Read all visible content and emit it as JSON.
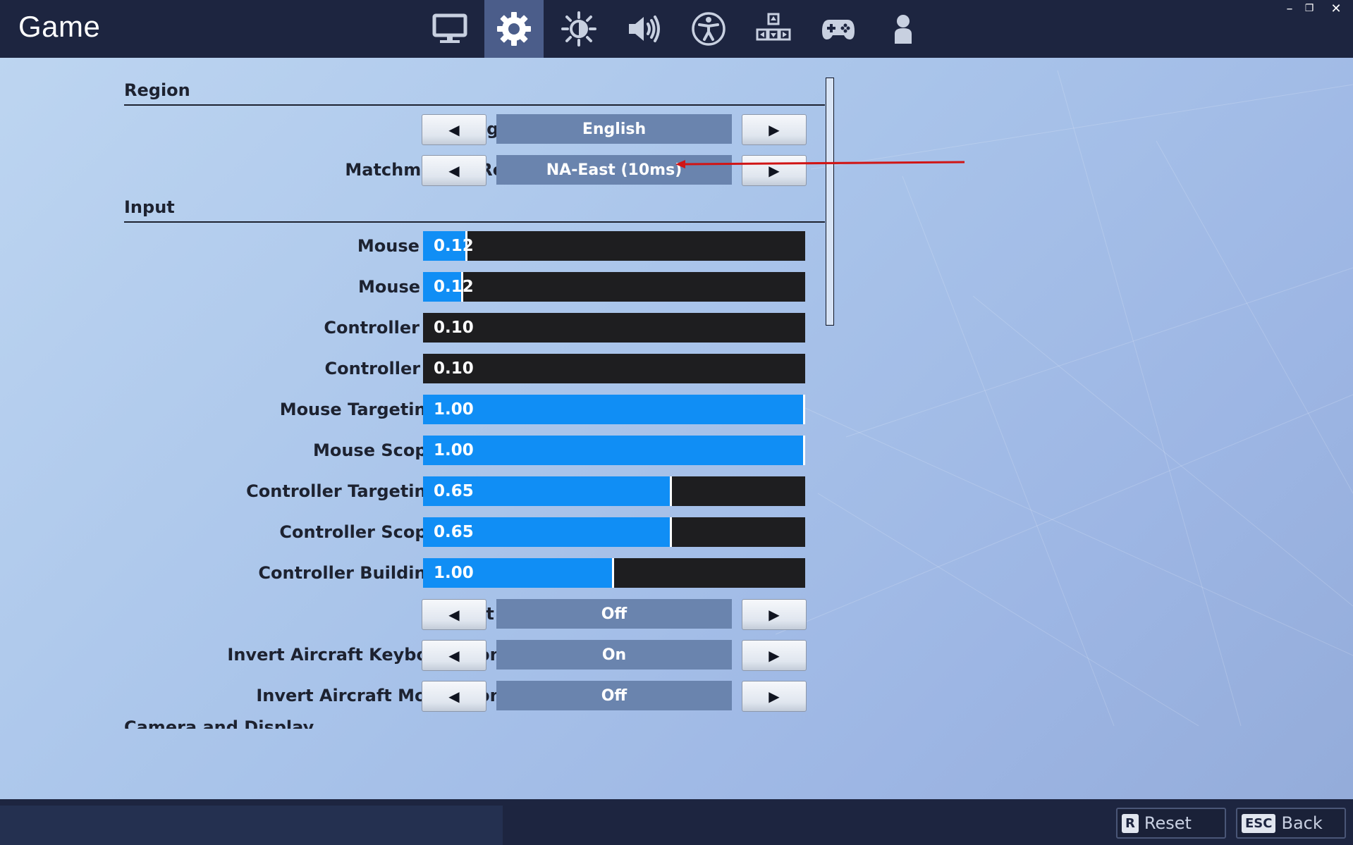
{
  "window": {
    "title": "Game",
    "controls": {
      "minimize": "–",
      "restore": "❐",
      "close": "✕"
    }
  },
  "tabs": [
    {
      "icon": "monitor-icon",
      "active": false
    },
    {
      "icon": "gear-icon",
      "active": true
    },
    {
      "icon": "brightness-icon",
      "active": false
    },
    {
      "icon": "speaker-icon",
      "active": false
    },
    {
      "icon": "accessibility-icon",
      "active": false
    },
    {
      "icon": "input-keys-icon",
      "active": false
    },
    {
      "icon": "gamepad-icon",
      "active": false
    },
    {
      "icon": "account-icon",
      "active": false
    }
  ],
  "sections": {
    "region": "Region",
    "input": "Input",
    "camera": "Camera and Display"
  },
  "region_rows": [
    {
      "label": "Language",
      "value": "English"
    },
    {
      "label": "Matchmaking Region",
      "value": "NA-East (10ms)"
    }
  ],
  "sliders": [
    {
      "label": "Mouse Sensitivity X",
      "value": "0.12",
      "fill": 0.11
    },
    {
      "label": "Mouse Sensitivity Y",
      "value": "0.12",
      "fill": 0.1
    },
    {
      "label": "Controller Sensitivity X",
      "value": "0.10",
      "fill": 0
    },
    {
      "label": "Controller Sensitivity Y",
      "value": "0.10",
      "fill": 0
    },
    {
      "label": "Mouse Targeting Sensitivity",
      "value": "1.00",
      "fill": 1.0
    },
    {
      "label": "Mouse Scope Sensitivity",
      "value": "1.00",
      "fill": 1.0
    },
    {
      "label": "Controller Targeting Sensitivity",
      "value": "0.65",
      "fill": 0.645
    },
    {
      "label": "Controller Scope Sensitivity",
      "value": "0.65",
      "fill": 0.645
    },
    {
      "label": "Controller Building Sensitivity",
      "value": "1.00",
      "fill": 0.495
    }
  ],
  "toggles": [
    {
      "label": "Invert View",
      "value": "Off"
    },
    {
      "label": "Invert Aircraft Keyboard Controls",
      "value": "On"
    },
    {
      "label": "Invert Aircraft Mouse Controls",
      "value": "Off"
    }
  ],
  "arrows": {
    "left": "◀",
    "right": "▶"
  },
  "footer": {
    "reset_key": "R",
    "reset_label": "Reset",
    "back_key": "ESC",
    "back_label": "Back"
  },
  "colors": {
    "topbar": "#1d2540",
    "active_tab": "#4b5d8a",
    "slider_fill": "#108ef5",
    "slider_track": "#1e1e20",
    "value_box": "#6a84ae",
    "annotation_arrow": "#d01515"
  }
}
